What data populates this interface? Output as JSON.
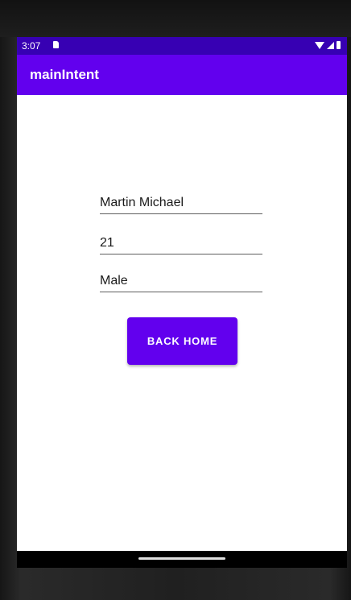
{
  "status_bar": {
    "time": "3:07",
    "icons": [
      "sim-card-icon",
      "wifi-icon",
      "signal-icon",
      "battery-icon"
    ],
    "background": "#3700b3"
  },
  "app_bar": {
    "title": "mainIntent",
    "background": "#6200ee"
  },
  "form": {
    "name": "Martin Michael",
    "age": "21",
    "gender": "Male"
  },
  "actions": {
    "back_home_label": "BACK HOME",
    "button_color": "#6200ee"
  },
  "nav_bar": {
    "handle": "gesture-handle"
  }
}
